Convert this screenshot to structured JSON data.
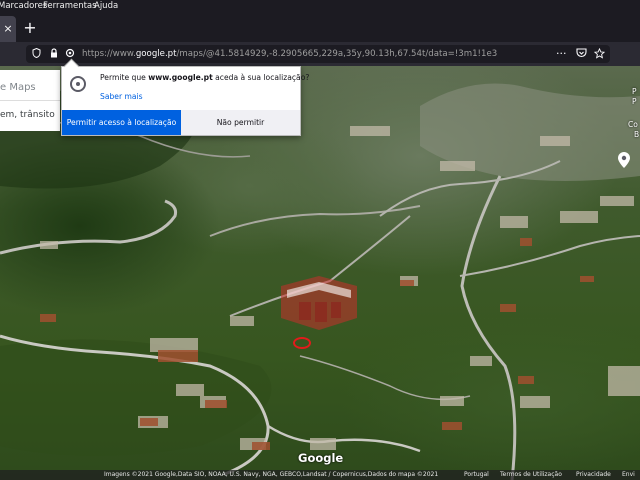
{
  "menubar": {
    "items": [
      "Marcadores",
      "Ferramentas",
      "Ajuda"
    ]
  },
  "tabbar": {
    "tab_close_glyph": "×",
    "new_tab_glyph": "+"
  },
  "navbar": {
    "url_prefix": "https://www.",
    "url_domain": "google.pt",
    "url_rest": "/maps/@41.5814929,-8.2905665,229a,35y,90.13h,67.54t/data=!3m1!1e3"
  },
  "maps_panel": {
    "search_placeholder": "e Maps",
    "directions_hint": "em, trânsito e"
  },
  "permission_popup": {
    "question_prefix": "Permite que ",
    "question_domain": "www.google.pt",
    "question_suffix": " aceda à sua localização?",
    "learn_more": "Saber mais",
    "allow_label": "Permitir acesso à localização",
    "deny_label": "Não permitir"
  },
  "map": {
    "logo": "Google",
    "right_labels": [
      "P",
      "P",
      "Co",
      "B"
    ],
    "footer": {
      "imagery": "Imagens ©2021 Google,Data SIO, NOAA, U.S. Navy, NGA, GEBCO,Landsat / Copernicus,Dados do mapa ©2021",
      "country": "Portugal",
      "terms": "Termos de Utilização",
      "privacy": "Privacidade",
      "send": "Envi"
    }
  },
  "colors": {
    "allow_button": "#0061e0",
    "browser_chrome": "#1c1b22",
    "marker": "#e21b1b"
  },
  "icons": [
    "shield-icon",
    "lock-icon",
    "location-permission-icon",
    "more-actions-icon",
    "pocket-icon",
    "bookmark-star-icon",
    "location-icon",
    "place-pin-icon"
  ]
}
